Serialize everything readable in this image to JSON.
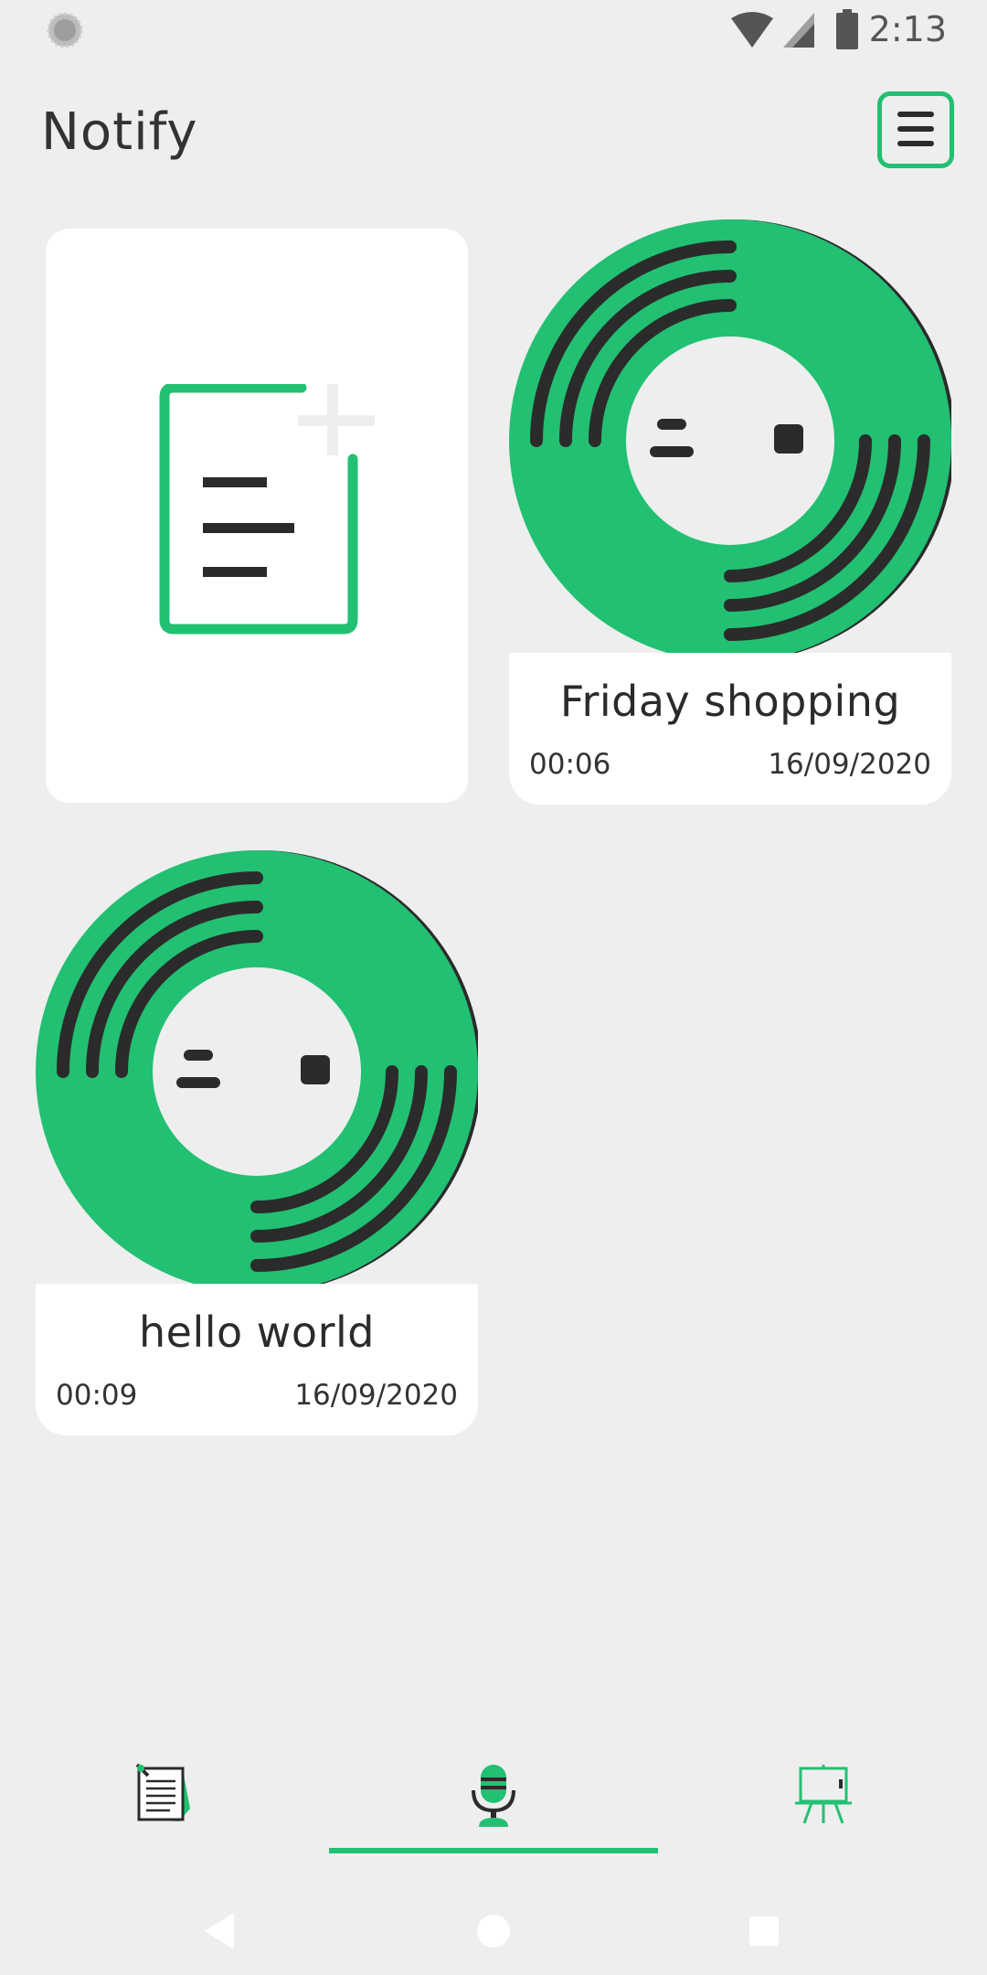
{
  "status_bar": {
    "time": "2:13",
    "icons": [
      "sync-icon",
      "wifi-icon",
      "signal-icon",
      "battery-icon"
    ]
  },
  "app_bar": {
    "title": "Notify",
    "menu_icon": "hamburger-menu-icon"
  },
  "new_note_card": {
    "icon": "add-note-icon"
  },
  "recordings": [
    {
      "title": "Friday shopping",
      "duration": "00:06",
      "date": "16/09/2020",
      "icon": "vinyl-record-icon"
    },
    {
      "title": "hello world",
      "duration": "00:09",
      "date": "16/09/2020",
      "icon": "vinyl-record-icon"
    }
  ],
  "bottom_nav": {
    "tabs": [
      {
        "icon": "notes-icon",
        "selected": false
      },
      {
        "icon": "microphone-icon",
        "selected": true
      },
      {
        "icon": "presentation-board-icon",
        "selected": false
      }
    ]
  },
  "system_nav": {
    "buttons": [
      "back-icon",
      "home-icon",
      "recents-icon"
    ]
  },
  "colors": {
    "accent": "#22c072",
    "dark": "#2b2b2b",
    "background": "#eeeeee",
    "card": "#ffffff"
  }
}
